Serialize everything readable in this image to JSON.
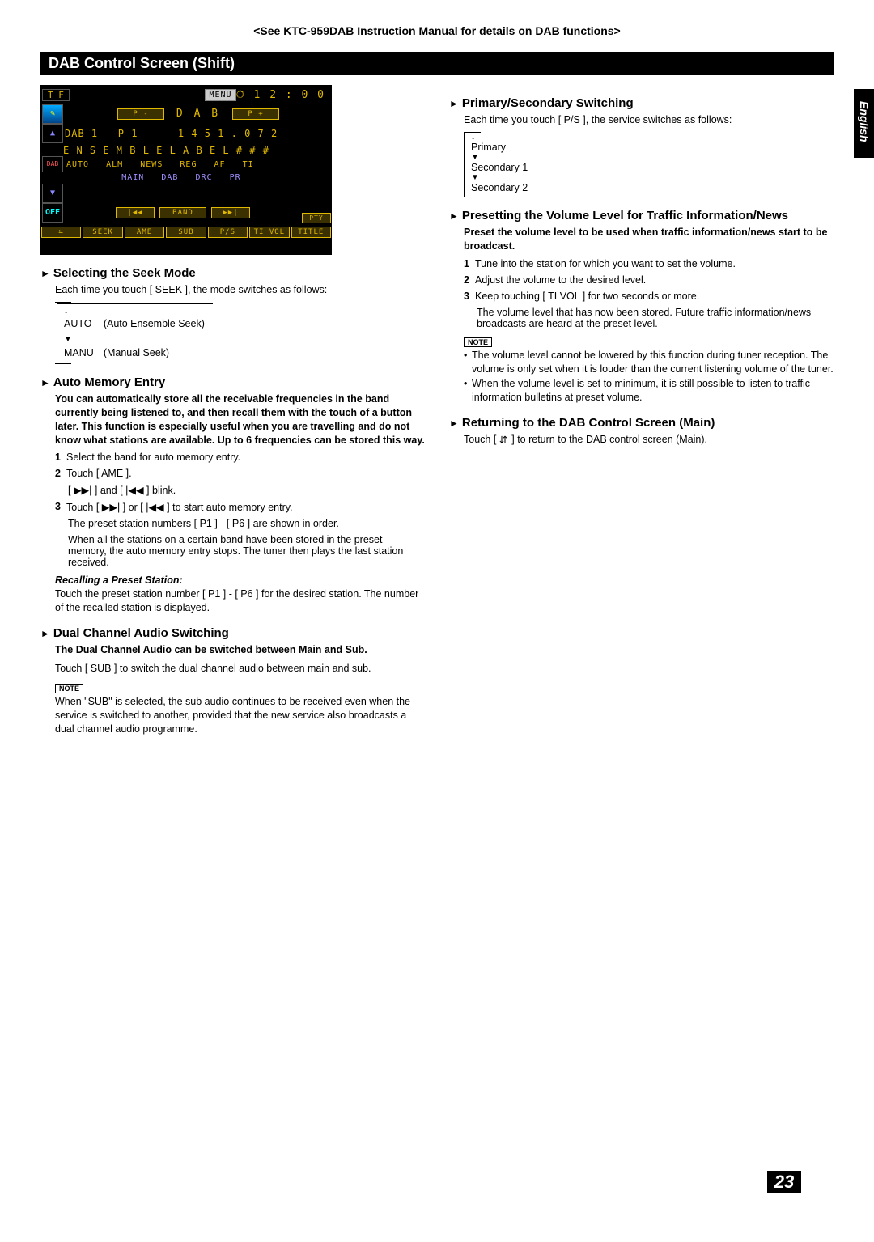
{
  "top_reference": "<See KTC-959DAB Instruction Manual for details on DAB functions>",
  "section_bar": "DAB Control Screen (Shift)",
  "lang_tab": "English",
  "page_number": "23",
  "screen": {
    "top": {
      "tf": "T F",
      "menu": "MENU",
      "clock": "⏱ 1 2 : 0 0"
    },
    "row2": {
      "pminus": "P -",
      "dab": "D A B",
      "pplus": "P +"
    },
    "info1": "DAB 1   P 1      1 4 5 1 . 0 7 2",
    "info2": "E N S E M B L E L A B E L # # #",
    "status1": "AUTO   ALM   NEWS   REG   AF   TI",
    "status2": "          MAIN   DAB   DRC   PR",
    "row_trans": {
      "prev": "|◀◀",
      "band": "BAND",
      "next": "▶▶|",
      "pty": "PTY"
    },
    "bottom": {
      "swap": "⇆",
      "seek": "SEEK",
      "ame": "AME",
      "sub": "SUB",
      "ps": "P/S",
      "tivol": "TI VOL",
      "title": "TITLE"
    },
    "side": {
      "up": "▲",
      "dab_icon": "DAB",
      "down": "▼",
      "off": "OFF"
    }
  },
  "left": {
    "h1": "Selecting the Seek Mode",
    "h1_body": "Each time you touch [ SEEK ], the mode switches as follows:",
    "seek_auto": "AUTO",
    "seek_auto_desc": "(Auto Ensemble Seek)",
    "seek_manu": "MANU",
    "seek_manu_desc": "(Manual Seek)",
    "h2": "Auto Memory Entry",
    "h2_intro": "You can automatically store all the receivable frequencies in the band currently being listened to, and then recall them with the touch of a button later. This function is especially useful when you are travelling and do not know what stations are available. Up to 6 frequencies can be stored this way.",
    "step1": "Select the band for auto memory entry.",
    "step2": "Touch [ AME ].",
    "step2b": "[ ▶▶| ] and [ |◀◀ ] blink.",
    "step3": "Touch [ ▶▶| ] or [ |◀◀ ] to start auto memory entry.",
    "step3b": "The preset station numbers [ P1 ] - [ P6 ] are shown in order.",
    "step3c": "When all the stations on a certain band have been stored in the preset memory, the auto memory entry stops. The tuner then plays the last station received.",
    "recall_head": "Recalling a Preset Station:",
    "recall_body": "Touch the preset station number [ P1 ] - [ P6 ] for the desired station. The number of the recalled station is displayed.",
    "h3": "Dual Channel Audio Switching",
    "h3_intro": "The Dual Channel Audio can be switched between Main and Sub.",
    "h3_body": "Touch [ SUB ] to switch the dual channel audio between main and sub.",
    "h3_note": "When \"SUB\" is selected, the sub audio continues to be received even when the service is switched to another, provided that the new service also broadcasts a dual channel audio programme."
  },
  "right": {
    "h1": "Primary/Secondary Switching",
    "h1_body": "Each time you touch [ P/S ], the service switches as follows:",
    "cycle": {
      "a": "Primary",
      "b": "Secondary 1",
      "c": "Secondary 2"
    },
    "h2": "Presetting the Volume Level for Traffic Information/News",
    "h2_intro": "Preset the volume level to be used when traffic information/news start to be broadcast.",
    "step1": "Tune into the station for which you want to set the volume.",
    "step2": "Adjust the volume to the desired level.",
    "step3": "Keep touching [ TI  VOL ] for two seconds or more.",
    "step3b": "The volume level that has now been stored. Future traffic information/news broadcasts are heard at the preset level.",
    "note1": "The volume level cannot be lowered by this function during tuner reception. The volume is only set when it is louder than the current listening volume of the tuner.",
    "note2": "When the volume level is set to minimum, it is still possible to listen to traffic information bulletins at preset volume.",
    "h3": "Returning to the DAB Control Screen (Main)",
    "h3_body_a": "Touch [ ",
    "h3_body_b": " ] to return to the DAB control screen (Main)."
  },
  "labels": {
    "note": "NOTE"
  }
}
